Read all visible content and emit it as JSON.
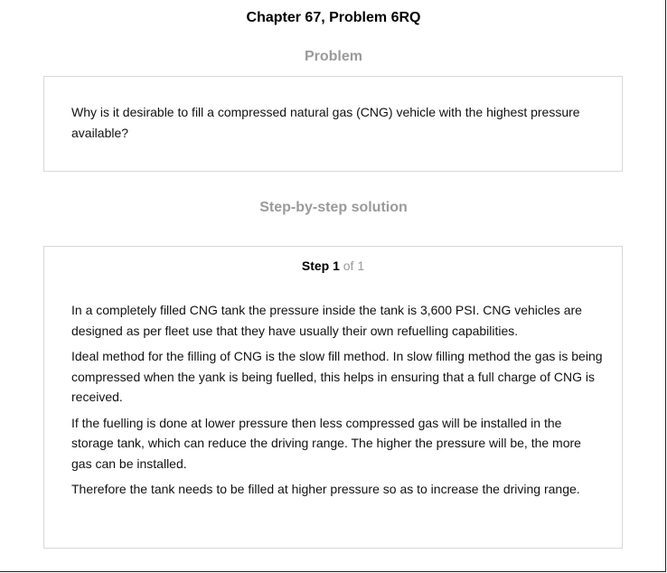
{
  "header": {
    "title": "Chapter 67, Problem 6RQ"
  },
  "problem": {
    "heading": "Problem",
    "text": "Why is it desirable to fill a compressed natural gas (CNG) vehicle with the highest pressure available?"
  },
  "solution": {
    "heading": "Step-by-step solution",
    "step_label": "Step 1",
    "step_of": "of 1",
    "paragraphs": [
      "In a completely filled CNG tank the pressure inside the tank is 3,600 PSI. CNG vehicles are designed as per fleet use that they have usually their own refuelling capabilities.",
      "Ideal method for the filling of CNG is the slow fill method. In slow filling method the gas is being compressed when the yank is being fuelled, this helps in ensuring that a full charge of CNG is received.",
      "If the fuelling is done at lower pressure then less compressed gas will be installed in the storage tank, which can reduce the driving range. The higher the pressure will be, the more gas can be installed.",
      "Therefore the tank needs to be filled at higher pressure so as to increase the driving range."
    ]
  }
}
